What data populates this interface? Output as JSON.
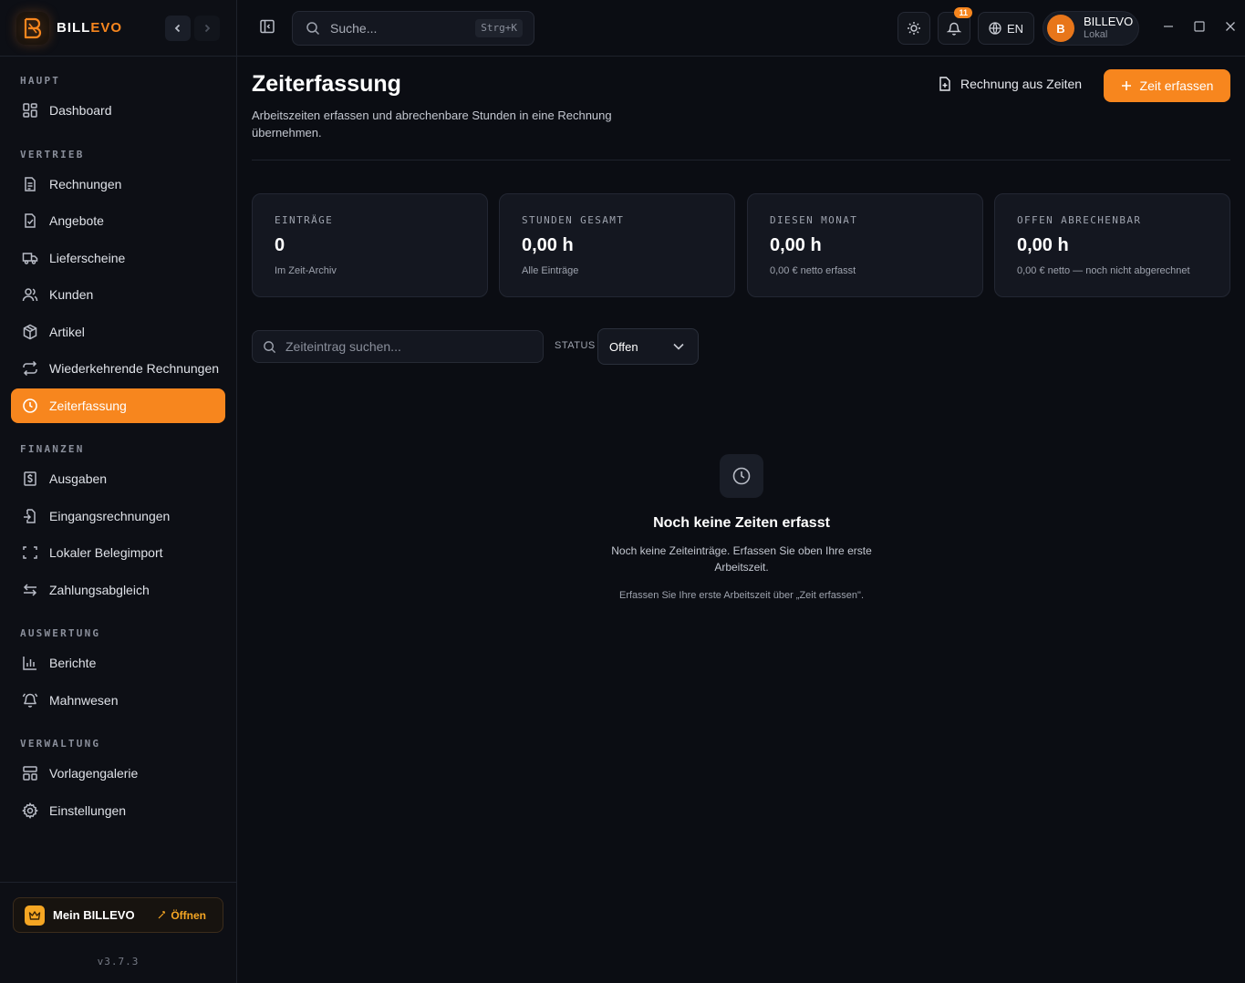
{
  "brand": {
    "name_part1": "BILL",
    "name_part2": "EVO"
  },
  "sidebar": {
    "sections": [
      {
        "title": "HAUPT"
      },
      {
        "title": "VERTRIEB"
      },
      {
        "title": "FINANZEN"
      },
      {
        "title": "AUSWERTUNG"
      },
      {
        "title": "VERWALTUNG"
      }
    ],
    "items": [
      {
        "label": "Dashboard",
        "icon": "dashboard-icon"
      },
      {
        "label": "Rechnungen",
        "icon": "document-icon"
      },
      {
        "label": "Angebote",
        "icon": "document-check-icon"
      },
      {
        "label": "Lieferscheine",
        "icon": "truck-icon"
      },
      {
        "label": "Kunden",
        "icon": "users-icon"
      },
      {
        "label": "Artikel",
        "icon": "box-icon"
      },
      {
        "label": "Wiederkehrende Rechnungen",
        "icon": "repeat-icon"
      },
      {
        "label": "Zeiterfassung",
        "icon": "clock-icon",
        "active": true
      },
      {
        "label": "Ausgaben",
        "icon": "dollar-icon"
      },
      {
        "label": "Eingangsrechnungen",
        "icon": "import-icon"
      },
      {
        "label": "Lokaler Belegimport",
        "icon": "scan-icon"
      },
      {
        "label": "Zahlungsabgleich",
        "icon": "swap-icon"
      },
      {
        "label": "Berichte",
        "icon": "chart-icon"
      },
      {
        "label": "Mahnwesen",
        "icon": "bell-icon"
      },
      {
        "label": "Vorlagengalerie",
        "icon": "layout-icon"
      },
      {
        "label": "Einstellungen",
        "icon": "gear-icon"
      }
    ],
    "footer": {
      "mein_label": "Mein BILLEVO",
      "open_label": "Öffnen",
      "version": "v3.7.3"
    }
  },
  "topbar": {
    "search_placeholder": "Suche...",
    "search_shortcut": "Strg+K",
    "notification_count": "11",
    "language": "EN",
    "user": {
      "initial": "B",
      "name": "BILLEVO",
      "sub": "Lokal"
    }
  },
  "page": {
    "title": "Zeiterfassung",
    "subtitle": "Arbeitszeiten erfassen und abrechenbare Stunden in eine Rechnung übernehmen.",
    "secondary_action": "Rechnung aus Zeiten",
    "primary_action": "Zeit erfassen"
  },
  "stats": [
    {
      "label": "EINTRÄGE",
      "value": "0",
      "sub": "Im Zeit-Archiv"
    },
    {
      "label": "STUNDEN GESAMT",
      "value": "0,00 h",
      "sub": "Alle Einträge"
    },
    {
      "label": "DIESEN MONAT",
      "value": "0,00 h",
      "sub": "0,00 € netto erfasst"
    },
    {
      "label": "OFFEN ABRECHENBAR",
      "value": "0,00 h",
      "sub": "0,00 € netto — noch nicht abgerechnet"
    }
  ],
  "filters": {
    "search_placeholder": "Zeiteintrag suchen...",
    "status_label": "STATUS",
    "status_value": "Offen"
  },
  "empty_state": {
    "title": "Noch keine Zeiten erfasst",
    "description": "Noch keine Zeiteinträge. Erfassen Sie oben Ihre erste Arbeitszeit.",
    "hint": "Erfassen Sie Ihre erste Arbeitszeit über „Zeit erfassen\"."
  },
  "colors": {
    "accent": "#f7861e",
    "background": "#0b0d13",
    "card": "#141720"
  }
}
